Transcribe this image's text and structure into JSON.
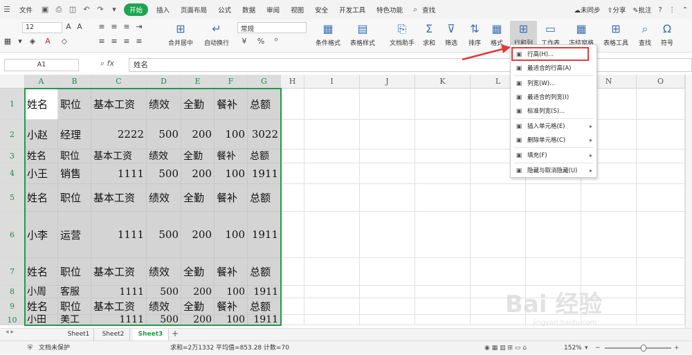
{
  "menubar": {
    "file": "文件",
    "items": [
      "开始",
      "插入",
      "页面布局",
      "公式",
      "数据",
      "审阅",
      "视图",
      "安全",
      "开发工具",
      "特色功能"
    ],
    "search": "查找",
    "right": [
      "未同步",
      "分享",
      "批注"
    ]
  },
  "ribbon": {
    "font_size": "12",
    "number_format": "常规",
    "merge": "合并居中",
    "wrap": "自动换行",
    "cond_format": "条件格式",
    "table_style": "表格样式",
    "doc_helper": "文档助手",
    "sum": "求和",
    "filter": "筛选",
    "sort": "排序",
    "format": "格式",
    "rowcol": "行和列",
    "sheet": "工作表",
    "freeze": "冻结窗格",
    "tools": "表格工具",
    "find": "查找",
    "symbol": "符号"
  },
  "formula_bar": {
    "namebox": "A1",
    "fx": "fx",
    "value": "姓名"
  },
  "columns": [
    "A",
    "B",
    "C",
    "D",
    "E",
    "F",
    "G",
    "H",
    "I",
    "J",
    "K",
    "L",
    "M",
    "N",
    "O"
  ],
  "rows": [
    "1",
    "2",
    "3",
    "4",
    "5",
    "6",
    "7",
    "8",
    "9",
    "10"
  ],
  "cells": [
    [
      "姓名",
      "职位",
      "基本工资",
      "绩效",
      "全勤",
      "餐补",
      "总额"
    ],
    [
      "小赵",
      "经理",
      "2222",
      "500",
      "200",
      "100",
      "3022"
    ],
    [
      "姓名",
      "职位",
      "基本工资",
      "绩效",
      "全勤",
      "餐补",
      "总额"
    ],
    [
      "小王",
      "销售",
      "1111",
      "500",
      "200",
      "100",
      "1911"
    ],
    [
      "姓名",
      "职位",
      "基本工资",
      "绩效",
      "全勤",
      "餐补",
      "总额"
    ],
    [
      "小李",
      "运营",
      "1111",
      "500",
      "200",
      "100",
      "1911"
    ],
    [
      "姓名",
      "职位",
      "基本工资",
      "绩效",
      "全勤",
      "餐补",
      "总额"
    ],
    [
      "小周",
      "客服",
      "1111",
      "500",
      "200",
      "100",
      "1911"
    ],
    [
      "姓名",
      "职位",
      "基本工资",
      "绩效",
      "全勤",
      "餐补",
      "总额"
    ],
    [
      "小田",
      "美工",
      "1111",
      "500",
      "200",
      "100",
      "1911"
    ]
  ],
  "dropdown": {
    "items": [
      {
        "label": "行高(H)...",
        "icon": "row-height-icon"
      },
      {
        "label": "最适合的行高(A)",
        "icon": "autofit-row-icon"
      },
      {
        "label": "列宽(W)...",
        "icon": "col-width-icon"
      },
      {
        "label": "最适合的列宽(I)",
        "icon": "autofit-col-icon"
      },
      {
        "label": "标准列宽(S)...",
        "icon": "std-width-icon"
      },
      {
        "label": "插入单元格(E)",
        "icon": "insert-cell-icon"
      },
      {
        "label": "删除单元格(C)",
        "icon": "delete-cell-icon"
      },
      {
        "label": "填充(F)",
        "icon": "fill-icon"
      },
      {
        "label": "隐藏与取消隐藏(U)",
        "icon": "hide-icon"
      }
    ]
  },
  "sheet_tabs": [
    "Sheet1",
    "Sheet2",
    "Sheet3"
  ],
  "status": {
    "protect": "文档未保护",
    "stats": "求和=2万1332  平均值=853.28  计数=70",
    "zoom": "152%"
  },
  "watermark": "Bai 经验",
  "watermark_sub": "jingyan.baidu.com",
  "colors": {
    "accent": "#1fa352",
    "selection": "#1f9a4c",
    "highlight_red": "#e03a3a"
  }
}
